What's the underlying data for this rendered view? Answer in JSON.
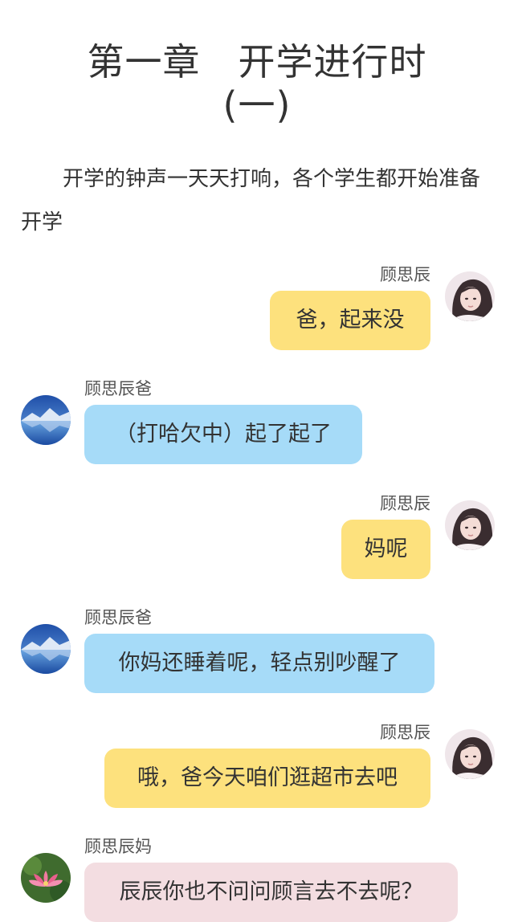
{
  "chapter": {
    "title_line1": "第一章　开学进行时",
    "title_line2": "(一)"
  },
  "intro": "开学的钟声一天天打响，各个学生都开始准备开学",
  "messages": [
    {
      "sender": "顾思辰",
      "text": "爸，起来没",
      "side": "right",
      "bubble_color": "#fde17d",
      "avatar": "girl-avatar"
    },
    {
      "sender": "顾思辰爸",
      "text": "（打哈欠中）起了起了",
      "side": "left",
      "bubble_color": "#a6dbf8",
      "avatar": "mountain-lake-avatar"
    },
    {
      "sender": "顾思辰",
      "text": "妈呢",
      "side": "right",
      "bubble_color": "#fde17d",
      "avatar": "girl-avatar"
    },
    {
      "sender": "顾思辰爸",
      "text": "你妈还睡着呢，轻点别吵醒了",
      "side": "left",
      "bubble_color": "#a6dbf8",
      "avatar": "mountain-lake-avatar"
    },
    {
      "sender": "顾思辰",
      "text": "哦，爸今天咱们逛超市去吧",
      "side": "right",
      "bubble_color": "#fde17d",
      "avatar": "girl-avatar"
    },
    {
      "sender": "顾思辰妈",
      "text": "辰辰你也不问问顾言去不去呢？",
      "side": "left",
      "bubble_color": "#f3dde1",
      "avatar": "lotus-avatar"
    }
  ]
}
